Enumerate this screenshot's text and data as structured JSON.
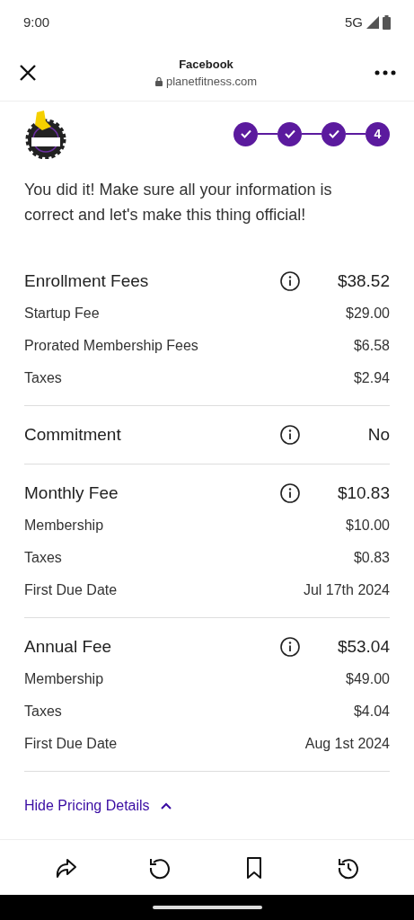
{
  "status_bar": {
    "time": "9:00",
    "network": "5G"
  },
  "browser": {
    "title": "Facebook",
    "url": "planetfitness.com"
  },
  "steps": [
    {
      "completed": true
    },
    {
      "completed": true
    },
    {
      "completed": true
    },
    {
      "completed": false,
      "label": "4"
    }
  ],
  "intro": "You did it! Make sure all your information is correct and let's make this thing official!",
  "sections": [
    {
      "title": "Enrollment Fees",
      "amount": "$38.52",
      "rows": [
        {
          "label": "Startup Fee",
          "value": "$29.00"
        },
        {
          "label": "Prorated Membership Fees",
          "value": "$6.58"
        },
        {
          "label": "Taxes",
          "value": "$2.94"
        }
      ]
    },
    {
      "title": "Commitment",
      "amount": "No"
    },
    {
      "title": "Monthly Fee",
      "amount": "$10.83",
      "rows": [
        {
          "label": "Membership",
          "value": "$10.00"
        },
        {
          "label": "Taxes",
          "value": "$0.83"
        },
        {
          "label": "First Due Date",
          "value": "Jul 17th 2024"
        }
      ]
    },
    {
      "title": "Annual Fee",
      "amount": "$53.04",
      "rows": [
        {
          "label": "Membership",
          "value": "$49.00"
        },
        {
          "label": "Taxes",
          "value": "$4.04"
        },
        {
          "label": "First Due Date",
          "value": "Aug 1st 2024"
        }
      ]
    }
  ],
  "toggle": {
    "label": "Hide Pricing Details",
    "expanded": true
  }
}
